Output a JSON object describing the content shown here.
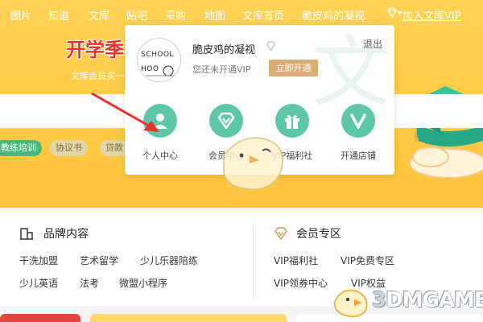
{
  "nav": {
    "items": [
      {
        "label": "图片"
      },
      {
        "label": "知道"
      },
      {
        "label": "文库"
      },
      {
        "label": "贴吧"
      },
      {
        "label": "采购"
      },
      {
        "label": "地图"
      },
      {
        "label": "文库首页"
      }
    ],
    "username": "脆皮鸡的凝视",
    "join_vip": "加入文库VIP"
  },
  "hero": {
    "logo_text": "开学季",
    "subtitle": "文库会员买一"
  },
  "tags": [
    {
      "label": "教练培训",
      "style": "green"
    },
    {
      "label": "协议书",
      "style": "tan"
    },
    {
      "label": "贷款",
      "style": "tan"
    }
  ],
  "popup": {
    "avatar_text": "SCHOOL",
    "username": "脆皮鸡的凝视",
    "vip_status": "您还未开通VIP",
    "open_button": "立即开通",
    "logout": "退出",
    "watermark_char": "文",
    "actions": [
      {
        "label": "个人中心",
        "icon": "person-icon"
      },
      {
        "label": "会员中心",
        "icon": "diamond-icon"
      },
      {
        "label": "VIP福利社",
        "icon": "gift-icon"
      },
      {
        "label": "开通店铺",
        "icon": "v-icon"
      }
    ]
  },
  "brand": {
    "title": "品牌内容",
    "links": [
      "干洗加盟",
      "艺术留学",
      "少儿乐器陪练",
      "少儿英语",
      "法考",
      "微盟小程序"
    ]
  },
  "member": {
    "title": "会员专区",
    "links": [
      "VIP福利社",
      "VIP免费专区",
      "VIP领券中心",
      "VIP权益"
    ]
  },
  "watermark": {
    "prefix": "3",
    "text": "DMGAME"
  },
  "colors": {
    "hero": "#ffcb45",
    "accent_green": "#5fc7a9",
    "tag_green": "#49b87a",
    "gold_button": "#d9ae74",
    "arrow_red": "#e8322f"
  }
}
